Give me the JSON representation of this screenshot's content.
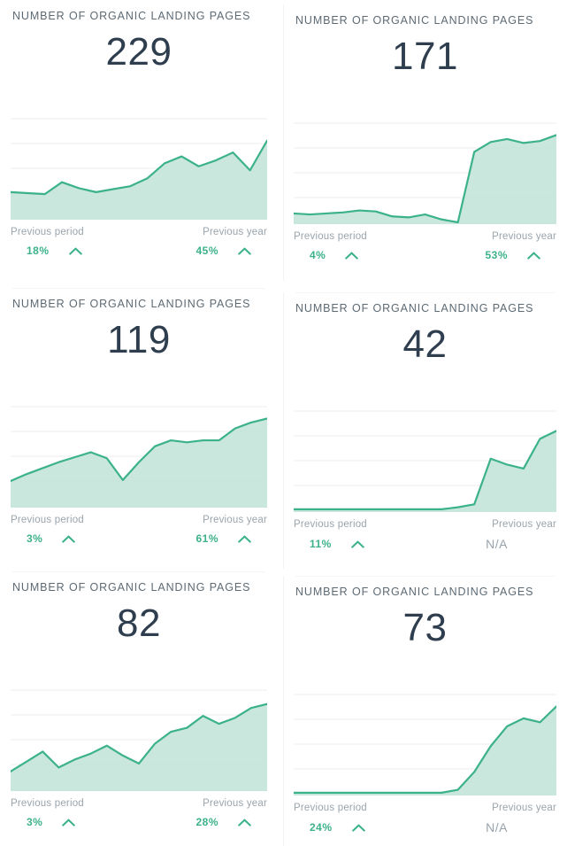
{
  "theme": {
    "accent_green": "#3cb28a",
    "area_fill": "#bfe3d7",
    "value_color": "#2f3e4e",
    "title_color": "#5d6a74",
    "muted_color": "#9aa4ac",
    "gridline_color": "#eceeef",
    "card_bg": "#ffffff"
  },
  "labels": {
    "previous_period": "Previous period",
    "previous_year": "Previous year",
    "up_arrow_icon": "chevron-up-icon",
    "not_available": "N/A"
  },
  "cards": [
    {
      "title": "NUMBER OF ORGANIC LANDING PAGES",
      "value": "229",
      "previous_period_pct": "18%",
      "previous_period_dir": "up",
      "previous_year_pct": "45%",
      "previous_year_dir": "up"
    },
    {
      "title": "NUMBER OF ORGANIC LANDING PAGES",
      "value": "171",
      "previous_period_pct": "4%",
      "previous_period_dir": "up",
      "previous_year_pct": "53%",
      "previous_year_dir": "up"
    },
    {
      "title": "NUMBER OF ORGANIC LANDING PAGES",
      "value": "119",
      "previous_period_pct": "3%",
      "previous_period_dir": "up",
      "previous_year_pct": "61%",
      "previous_year_dir": "up"
    },
    {
      "title": "NUMBER OF ORGANIC LANDING PAGES",
      "value": "42",
      "previous_period_pct": "11%",
      "previous_period_dir": "up",
      "previous_year_pct": "N/A",
      "previous_year_dir": "none"
    },
    {
      "title": "NUMBER OF ORGANIC LANDING PAGES",
      "value": "82",
      "previous_period_pct": "3%",
      "previous_period_dir": "up",
      "previous_year_pct": "28%",
      "previous_year_dir": "up"
    },
    {
      "title": "NUMBER OF ORGANIC LANDING PAGES",
      "value": "73",
      "previous_period_pct": "24%",
      "previous_period_dir": "up",
      "previous_year_pct": "N/A",
      "previous_year_dir": "none"
    }
  ],
  "chart_data": [
    {
      "type": "area",
      "title": "NUMBER OF ORGANIC LANDING PAGES",
      "card_index": 0,
      "xlabel": "",
      "ylabel": "",
      "grid": true,
      "gridlines": 4,
      "ylim": [
        0,
        100
      ],
      "x": [
        0,
        1,
        2,
        3,
        4,
        5,
        6,
        7,
        8,
        9,
        10,
        11,
        12,
        13,
        14,
        15
      ],
      "values": [
        26,
        25,
        24,
        36,
        30,
        26,
        29,
        32,
        40,
        55,
        62,
        52,
        58,
        66,
        48,
        78
      ]
    },
    {
      "type": "area",
      "title": "NUMBER OF ORGANIC LANDING PAGES",
      "card_index": 1,
      "xlabel": "",
      "ylabel": "",
      "grid": true,
      "gridlines": 4,
      "ylim": [
        0,
        100
      ],
      "x": [
        0,
        1,
        2,
        3,
        4,
        5,
        6,
        7,
        8,
        9,
        10,
        11,
        12,
        13,
        14,
        15
      ],
      "values": [
        9,
        8,
        9,
        10,
        12,
        11,
        6,
        5,
        8,
        3,
        0,
        71,
        81,
        84,
        80,
        82,
        88
      ]
    },
    {
      "type": "area",
      "title": "NUMBER OF ORGANIC LANDING PAGES",
      "card_index": 2,
      "xlabel": "",
      "ylabel": "",
      "grid": true,
      "gridlines": 4,
      "ylim": [
        0,
        100
      ],
      "x": [
        0,
        1,
        2,
        3,
        4,
        5,
        6,
        7,
        8,
        9,
        10,
        11,
        12,
        13,
        14,
        15
      ],
      "values": [
        25,
        32,
        38,
        44,
        49,
        54,
        48,
        26,
        44,
        60,
        66,
        64,
        66,
        66,
        78,
        84,
        88
      ]
    },
    {
      "type": "area",
      "title": "NUMBER OF ORGANIC LANDING PAGES",
      "card_index": 3,
      "xlabel": "",
      "ylabel": "",
      "grid": true,
      "gridlines": 4,
      "ylim": [
        0,
        100
      ],
      "x": [
        0,
        1,
        2,
        3,
        4,
        5,
        6,
        7,
        8,
        9,
        10,
        11,
        12,
        13,
        14,
        15
      ],
      "values": [
        1,
        1,
        1,
        1,
        1,
        1,
        1,
        1,
        1,
        1,
        3,
        6,
        52,
        46,
        42,
        72,
        80
      ]
    },
    {
      "type": "area",
      "title": "NUMBER OF ORGANIC LANDING PAGES",
      "card_index": 4,
      "xlabel": "",
      "ylabel": "",
      "grid": true,
      "gridlines": 4,
      "ylim": [
        0,
        100
      ],
      "x": [
        0,
        1,
        2,
        3,
        4,
        5,
        6,
        7,
        8,
        9,
        10,
        11,
        12,
        13,
        14,
        15
      ],
      "values": [
        18,
        28,
        38,
        22,
        30,
        36,
        44,
        34,
        26,
        46,
        58,
        62,
        74,
        66,
        72,
        82,
        86
      ]
    },
    {
      "type": "area",
      "title": "NUMBER OF ORGANIC LANDING PAGES",
      "card_index": 5,
      "xlabel": "",
      "ylabel": "",
      "grid": true,
      "gridlines": 4,
      "ylim": [
        0,
        100
      ],
      "x": [
        0,
        1,
        2,
        3,
        4,
        5,
        6,
        7,
        8,
        9,
        10,
        11,
        12,
        13,
        14,
        15
      ],
      "values": [
        1,
        1,
        1,
        1,
        1,
        1,
        1,
        1,
        1,
        1,
        4,
        22,
        48,
        68,
        76,
        72,
        88
      ]
    }
  ]
}
